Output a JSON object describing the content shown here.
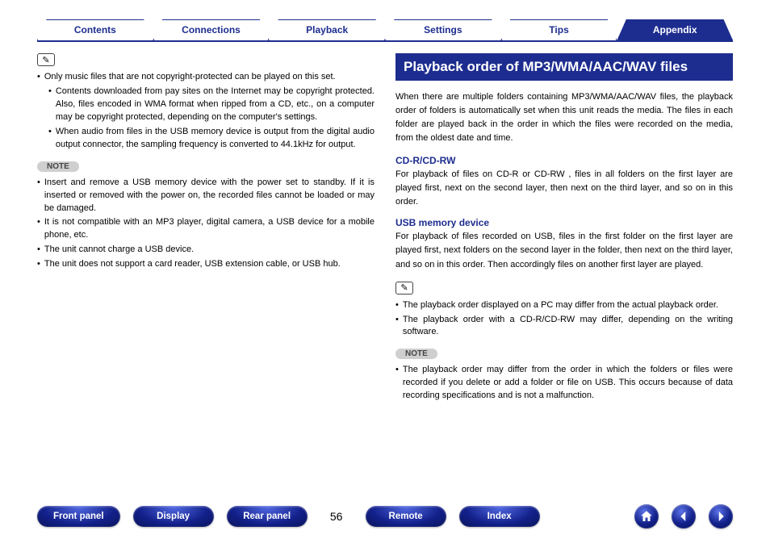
{
  "tabs": {
    "contents": "Contents",
    "connections": "Connections",
    "playback": "Playback",
    "settings": "Settings",
    "tips": "Tips",
    "appendix": "Appendix"
  },
  "left": {
    "b1": "Only music files that are not copyright-protected can be played on this set.",
    "b1a": "Contents downloaded from pay sites on the Internet may be copyright protected. Also, files encoded in WMA format when ripped from a CD, etc., on a computer may be copyright protected, depending on the computer's settings.",
    "b1b": "When audio from files in the USB memory device is output from the digital audio output connector, the sampling frequency is converted to 44.1kHz for output.",
    "note_label": "NOTE",
    "n1": "Insert and remove a USB memory device with the power set to standby. If it is inserted or removed with the power on, the recorded files cannot be loaded or may be damaged.",
    "n2": "It is not compatible with an MP3 player, digital camera, a USB device for a mobile phone, etc.",
    "n3": "The unit cannot charge a USB device.",
    "n4": "The unit does not support a card reader, USB extension cable, or USB hub."
  },
  "right": {
    "heading": "Playback order of MP3/WMA/AAC/WAV files",
    "intro": "When there are multiple folders containing MP3/WMA/AAC/WAV files, the playback order of folders is automatically set when this unit reads the media. The files in each folder are played back in the order in which the files were recorded on the media, from the oldest date and time.",
    "sub1_title": "CD-R/CD-RW",
    "sub1_body": "For playback of files on CD-R or CD-RW , files in all folders on the first layer are played first, next on the second layer, then next on the third layer, and so on in this order.",
    "sub2_title": "USB memory device",
    "sub2_body": "For playback of files recorded on USB, files in the first folder on the first layer are played first, next folders on the second layer in the folder, then next on the third layer, and so on in this order. Then accordingly files on another first layer are played.",
    "tip1": "The playback order displayed on a PC may differ from the actual playback order.",
    "tip2": "The playback order with a CD-R/CD-RW may differ, depending on the writing software.",
    "note_label": "NOTE",
    "note_body": "The playback order may differ from the order in which the folders or files were recorded if you delete or add a folder or file on USB. This occurs because of data recording specifications and is not a malfunction."
  },
  "bottom": {
    "front_panel": "Front panel",
    "display": "Display",
    "rear_panel": "Rear panel",
    "page": "56",
    "remote": "Remote",
    "index": "Index"
  }
}
